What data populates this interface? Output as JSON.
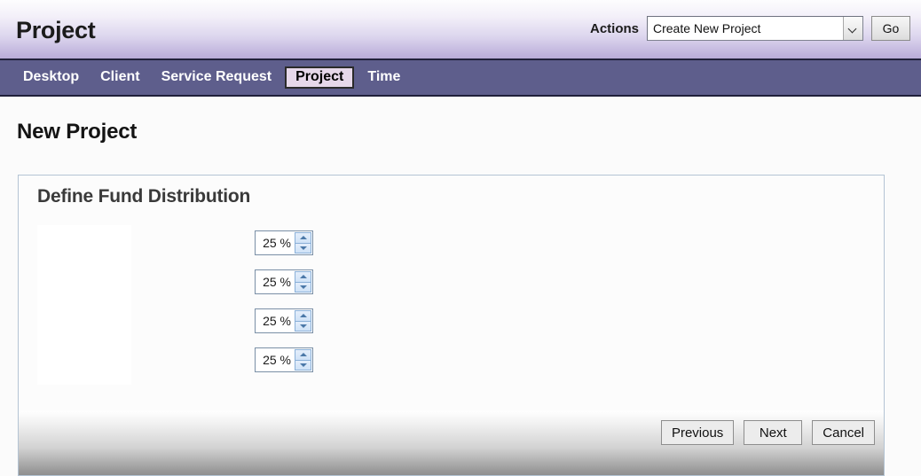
{
  "header": {
    "title": "Project",
    "actions_label": "Actions",
    "actions_select": {
      "value": "Create New Project",
      "options": [
        "Create New Project"
      ],
      "arrow_icon": "chevron-down-icon"
    },
    "go_label": "Go"
  },
  "nav": {
    "items": [
      {
        "label": "Desktop",
        "active": false
      },
      {
        "label": "Client",
        "active": false
      },
      {
        "label": "Service Request",
        "active": false
      },
      {
        "label": "Project",
        "active": true
      },
      {
        "label": "Time",
        "active": false
      }
    ]
  },
  "page": {
    "title": "New Project"
  },
  "panel": {
    "title": "Define Fund Distribution",
    "spinners": [
      {
        "value": "25 %",
        "up_icon": "triangle-up-icon",
        "down_icon": "triangle-down-icon"
      },
      {
        "value": "25 %",
        "up_icon": "triangle-up-icon",
        "down_icon": "triangle-down-icon"
      },
      {
        "value": "25 %",
        "up_icon": "triangle-up-icon",
        "down_icon": "triangle-down-icon"
      },
      {
        "value": "25 %",
        "up_icon": "triangle-up-icon",
        "down_icon": "triangle-down-icon"
      }
    ],
    "footer_buttons": [
      {
        "label": "Previous"
      },
      {
        "label": "Next"
      },
      {
        "label": "Cancel"
      }
    ]
  },
  "colors": {
    "nav_bar": "#5e5e8c",
    "nav_active_bg": "#e6d8ea",
    "header_gradient_end": "#b8abd8",
    "panel_border": "#b4c4d4",
    "spinner_button": "#cfe2f7"
  }
}
